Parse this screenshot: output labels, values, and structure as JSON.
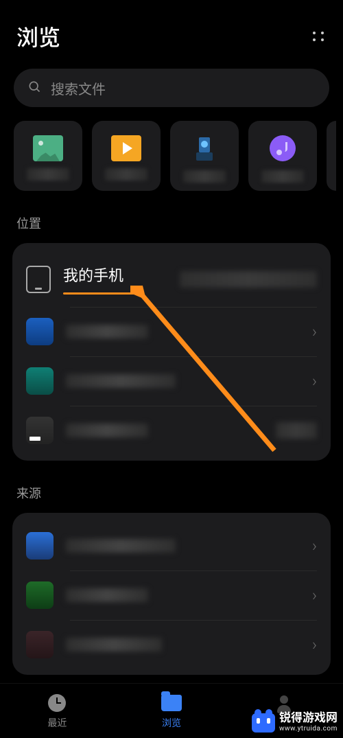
{
  "header": {
    "title": "浏览"
  },
  "search": {
    "placeholder": "搜索文件"
  },
  "sections": {
    "location_title": "位置",
    "source_title": "来源"
  },
  "location": {
    "my_phone": "我的手机"
  },
  "nav": {
    "recent": "最近",
    "browse": "浏览"
  },
  "watermark": {
    "brand": "锐得游戏网",
    "url": "www.ytruida.com"
  }
}
